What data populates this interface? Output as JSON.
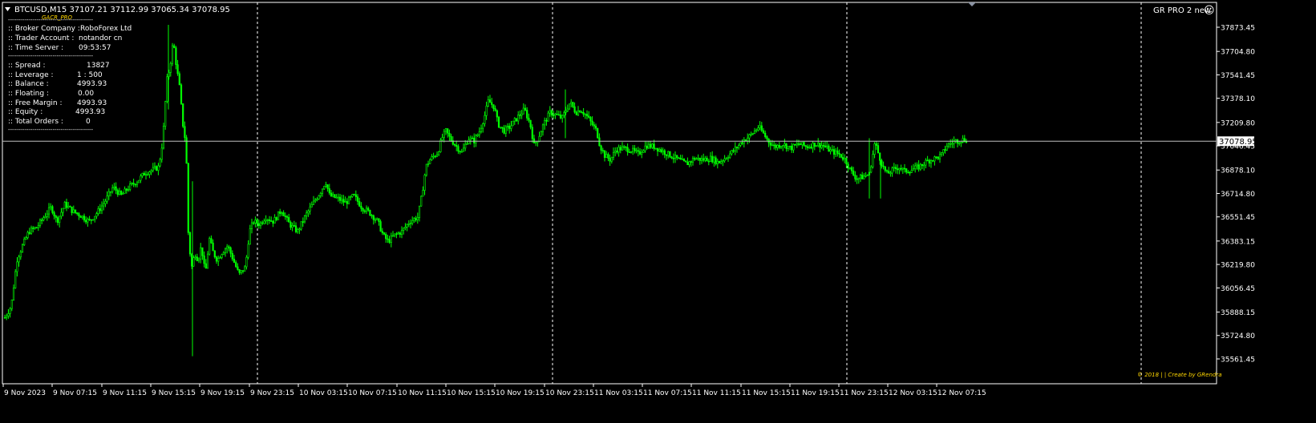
{
  "header": {
    "symbol_info": "BTCUSD,M15  37107.21 37112.99 37065.34 37078.95",
    "indicator_name": "GR PRO 2 new",
    "smiley": "☺",
    "logo": "GACR_PRO"
  },
  "info_panel": {
    "divider": "------------------------------------------",
    "rows_group1": [
      {
        "label": ":: Broker Company :",
        "value": "RoboForex Ltd"
      },
      {
        "label": ":: Trader Account :",
        "value": "notandor cn"
      },
      {
        "label": ":: Time Server :",
        "value": "09:53:57"
      }
    ],
    "rows_group2": [
      {
        "label": ":: Spread :",
        "value": "13827"
      },
      {
        "label": ":: Leverage :",
        "value": "1 : 500"
      },
      {
        "label": ":: Balance :",
        "value": "4993.93"
      },
      {
        "label": ":: Floating :",
        "value": "0.00"
      },
      {
        "label": ":: Free Margin :",
        "value": "4993.93"
      },
      {
        "label": ":: Equity :",
        "value": "4993.93"
      },
      {
        "label": ":: Total Orders :",
        "value": "0"
      }
    ]
  },
  "footer_credit": "© 2018 | | Create by GRendra",
  "current_price": "37078.95",
  "colors": {
    "candle": "#00ff00",
    "background": "#000000",
    "grid": "#ffffff",
    "text": "#ffffff",
    "credit": "#ffd700"
  },
  "chart_data": {
    "type": "candlestick",
    "symbol": "BTCUSD",
    "timeframe": "M15",
    "ylim": [
      35561.45,
      37950
    ],
    "ytick_labels": [
      "37873.45",
      "37704.80",
      "37541.45",
      "37378.10",
      "37209.80",
      "37046.45",
      "36878.10",
      "36714.80",
      "36551.45",
      "36383.15",
      "36219.80",
      "36056.45",
      "35888.15",
      "35724.80",
      "35561.45"
    ],
    "xtick_labels": [
      "9 Nov 2023",
      "9 Nov 07:15",
      "9 Nov 11:15",
      "9 Nov 15:15",
      "9 Nov 19:15",
      "9 Nov 23:15",
      "10 Nov 03:15",
      "10 Nov 07:15",
      "10 Nov 11:15",
      "10 Nov 15:15",
      "10 Nov 19:15",
      "10 Nov 23:15",
      "11 Nov 03:15",
      "11 Nov 07:15",
      "11 Nov 11:15",
      "11 Nov 15:15",
      "11 Nov 19:15",
      "11 Nov 23:15",
      "12 Nov 03:15",
      "12 Nov 07:15"
    ],
    "current_price": 37078.95,
    "close_path": [
      [
        0,
        35850
      ],
      [
        8,
        35930
      ],
      [
        15,
        36250
      ],
      [
        22,
        36350
      ],
      [
        30,
        36450
      ],
      [
        40,
        36480
      ],
      [
        50,
        36560
      ],
      [
        58,
        36620
      ],
      [
        65,
        36520
      ],
      [
        75,
        36640
      ],
      [
        85,
        36590
      ],
      [
        95,
        36560
      ],
      [
        105,
        36520
      ],
      [
        115,
        36580
      ],
      [
        125,
        36660
      ],
      [
        135,
        36760
      ],
      [
        145,
        36700
      ],
      [
        155,
        36760
      ],
      [
        165,
        36800
      ],
      [
        175,
        36860
      ],
      [
        185,
        36880
      ],
      [
        192,
        36900
      ],
      [
        197,
        37090
      ],
      [
        202,
        37500
      ],
      [
        206,
        37600
      ],
      [
        210,
        37780
      ],
      [
        214,
        37600
      ],
      [
        218,
        37450
      ],
      [
        222,
        37200
      ],
      [
        226,
        37050
      ],
      [
        229,
        36400
      ],
      [
        233,
        36200
      ],
      [
        237,
        36300
      ],
      [
        241,
        36250
      ],
      [
        245,
        36350
      ],
      [
        250,
        36150
      ],
      [
        255,
        36400
      ],
      [
        260,
        36300
      ],
      [
        265,
        36250
      ],
      [
        270,
        36300
      ],
      [
        278,
        36350
      ],
      [
        285,
        36250
      ],
      [
        292,
        36150
      ],
      [
        300,
        36200
      ],
      [
        305,
        36450
      ],
      [
        310,
        36520
      ],
      [
        318,
        36500
      ],
      [
        325,
        36550
      ],
      [
        335,
        36520
      ],
      [
        345,
        36600
      ],
      [
        355,
        36500
      ],
      [
        365,
        36450
      ],
      [
        375,
        36560
      ],
      [
        385,
        36650
      ],
      [
        395,
        36740
      ],
      [
        400,
        36800
      ],
      [
        405,
        36700
      ],
      [
        415,
        36680
      ],
      [
        425,
        36650
      ],
      [
        435,
        36700
      ],
      [
        445,
        36620
      ],
      [
        455,
        36580
      ],
      [
        465,
        36520
      ],
      [
        472,
        36420
      ],
      [
        478,
        36380
      ],
      [
        485,
        36420
      ],
      [
        495,
        36450
      ],
      [
        505,
        36520
      ],
      [
        515,
        36550
      ],
      [
        520,
        36700
      ],
      [
        525,
        36900
      ],
      [
        530,
        36950
      ],
      [
        540,
        37000
      ],
      [
        545,
        37100
      ],
      [
        550,
        37150
      ],
      [
        555,
        37100
      ],
      [
        562,
        37050
      ],
      [
        570,
        37000
      ],
      [
        578,
        37100
      ],
      [
        585,
        37080
      ],
      [
        592,
        37150
      ],
      [
        598,
        37250
      ],
      [
        603,
        37360
      ],
      [
        610,
        37320
      ],
      [
        615,
        37200
      ],
      [
        622,
        37150
      ],
      [
        630,
        37180
      ],
      [
        640,
        37250
      ],
      [
        648,
        37300
      ],
      [
        655,
        37200
      ],
      [
        660,
        37050
      ],
      [
        665,
        37100
      ],
      [
        672,
        37200
      ],
      [
        680,
        37280
      ],
      [
        688,
        37260
      ],
      [
        695,
        37240
      ],
      [
        700,
        37300
      ],
      [
        705,
        37350
      ],
      [
        712,
        37280
      ],
      [
        718,
        37300
      ],
      [
        725,
        37260
      ],
      [
        732,
        37200
      ],
      [
        738,
        37150
      ],
      [
        742,
        37050
      ],
      [
        748,
        36980
      ],
      [
        755,
        36950
      ],
      [
        762,
        37020
      ],
      [
        770,
        37030
      ],
      [
        780,
        37020
      ],
      [
        790,
        36990
      ],
      [
        800,
        37050
      ],
      [
        810,
        37040
      ],
      [
        820,
        37010
      ],
      [
        830,
        36980
      ],
      [
        840,
        36950
      ],
      [
        850,
        36920
      ],
      [
        860,
        36960
      ],
      [
        870,
        36950
      ],
      [
        880,
        36960
      ],
      [
        890,
        36930
      ],
      [
        900,
        36970
      ],
      [
        910,
        37020
      ],
      [
        920,
        37080
      ],
      [
        930,
        37120
      ],
      [
        940,
        37180
      ],
      [
        945,
        37140
      ],
      [
        952,
        37080
      ],
      [
        960,
        37040
      ],
      [
        970,
        37060
      ],
      [
        980,
        37030
      ],
      [
        990,
        37060
      ],
      [
        1000,
        37040
      ],
      [
        1010,
        37060
      ],
      [
        1020,
        37050
      ],
      [
        1030,
        37010
      ],
      [
        1040,
        36990
      ],
      [
        1048,
        36950
      ],
      [
        1055,
        36870
      ],
      [
        1062,
        36820
      ],
      [
        1070,
        36830
      ],
      [
        1078,
        36850
      ],
      [
        1085,
        37070
      ],
      [
        1090,
        36980
      ],
      [
        1095,
        36900
      ],
      [
        1100,
        36850
      ],
      [
        1108,
        36880
      ],
      [
        1115,
        36900
      ],
      [
        1122,
        36870
      ],
      [
        1130,
        36880
      ],
      [
        1140,
        36900
      ],
      [
        1150,
        36940
      ],
      [
        1160,
        36960
      ],
      [
        1168,
        36980
      ],
      [
        1175,
        37050
      ],
      [
        1185,
        37080
      ],
      [
        1195,
        37090
      ],
      [
        1205,
        37085
      ]
    ]
  }
}
